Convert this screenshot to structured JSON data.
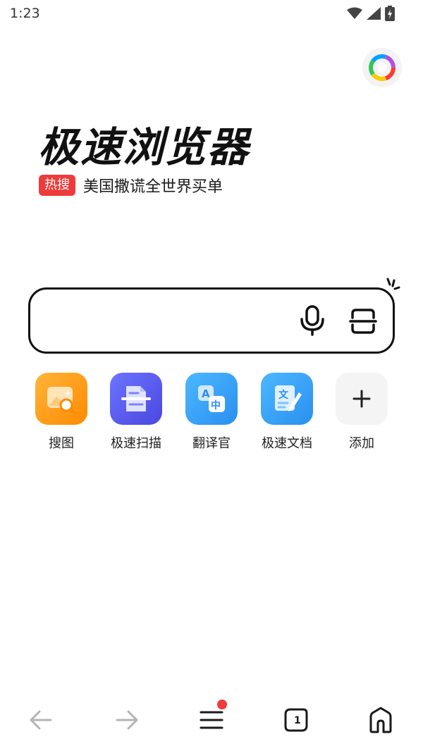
{
  "status_bar": {
    "time": "1:23"
  },
  "brand": {
    "title": "极速浏览器",
    "hot_badge": "热搜",
    "hot_topic": "美国撒谎全世界买单"
  },
  "search": {
    "placeholder": ""
  },
  "quick_actions": [
    {
      "label": "搜图",
      "icon": "image-search-icon",
      "color": "#ff9f1a"
    },
    {
      "label": "极速扫描",
      "icon": "document-scan-icon",
      "color": "#5b5ff0"
    },
    {
      "label": "翻译官",
      "icon": "translate-icon",
      "color": "#3aa6f5"
    },
    {
      "label": "极速文档",
      "icon": "document-edit-icon",
      "color": "#3aa6f5"
    },
    {
      "label": "添加",
      "icon": "plus-icon",
      "color": "#f4f4f4"
    }
  ],
  "bottom_nav": {
    "tab_count": "1",
    "items": [
      "back-arrow-icon",
      "forward-arrow-icon",
      "menu-icon",
      "tabs-icon",
      "home-icon"
    ]
  }
}
